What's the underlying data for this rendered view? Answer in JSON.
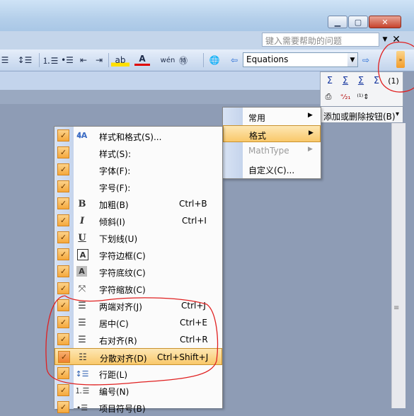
{
  "window": {
    "min_icon": "minimize-icon",
    "max_icon": "maximize-icon",
    "close_icon": "close-icon",
    "min_glyph": "▁",
    "max_glyph": "▢",
    "close_glyph": "✕"
  },
  "help": {
    "placeholder": "键入需要帮助的问题",
    "drop_glyph": "▼",
    "close_glyph": "✕"
  },
  "toolbar": {
    "equation_value": "Equations",
    "equation_drop_glyph": "▼",
    "back_glyph": "⇦",
    "forward_glyph": "⇨",
    "overflow_glyph": "»",
    "glyphs": {
      "distribute": "☰",
      "line_spacing": "↕☰",
      "numbering": "⒈☰",
      "bullets": "•☰",
      "decrease_indent": "⇤",
      "increase_indent": "⇥",
      "highlight": "ab",
      "font_color": "A",
      "phonetic": "wén",
      "enclose": "㊕",
      "globe": "🌐"
    }
  },
  "mathtype_panel": {
    "row1": [
      "Σ",
      "Σ",
      "Σ",
      "Σ",
      "(1)"
    ],
    "row2": [
      "⎙",
      "⁺⁄₂₁",
      "⁽¹⁾⇕"
    ],
    "add_remove_label": "添加或删除按钮(B)",
    "add_remove_arrow": "▾"
  },
  "submenu": {
    "items": [
      {
        "label": "常用",
        "arrow": "▶"
      },
      {
        "label": "格式",
        "arrow": "▶"
      },
      {
        "label": "MathType",
        "arrow": "▶"
      },
      {
        "label": "自定义(C)...",
        "arrow": ""
      }
    ]
  },
  "menu": {
    "check_glyph": "✓",
    "items": [
      {
        "label": "样式和格式(S)...",
        "shortcut": "",
        "icon": "styles-icon",
        "glyph": "𝟒A"
      },
      {
        "label": "样式(S):",
        "shortcut": "",
        "icon": "",
        "glyph": ""
      },
      {
        "label": "字体(F):",
        "shortcut": "",
        "icon": "",
        "glyph": ""
      },
      {
        "label": "字号(F):",
        "shortcut": "",
        "icon": "",
        "glyph": ""
      },
      {
        "label": "加粗(B)",
        "shortcut": "Ctrl+B",
        "icon": "bold-icon",
        "glyph": "B"
      },
      {
        "label": "倾斜(I)",
        "shortcut": "Ctrl+I",
        "icon": "italic-icon",
        "glyph": "I"
      },
      {
        "label": "下划线(U)",
        "shortcut": "",
        "icon": "underline-icon",
        "glyph": "U"
      },
      {
        "label": "字符边框(C)",
        "shortcut": "",
        "icon": "char-border-icon",
        "glyph": "A"
      },
      {
        "label": "字符底纹(C)",
        "shortcut": "",
        "icon": "char-shading-icon",
        "glyph": "A"
      },
      {
        "label": "字符缩放(C)",
        "shortcut": "",
        "icon": "char-scale-icon",
        "glyph": "⤧"
      },
      {
        "label": "两端对齐(J)",
        "shortcut": "Ctrl+J",
        "icon": "justify-icon",
        "glyph": "☰"
      },
      {
        "label": "居中(C)",
        "shortcut": "Ctrl+E",
        "icon": "align-center-icon",
        "glyph": "☰"
      },
      {
        "label": "右对齐(R)",
        "shortcut": "Ctrl+R",
        "icon": "align-right-icon",
        "glyph": "☰"
      },
      {
        "label": "分散对齐(D)",
        "shortcut": "Ctrl+Shift+J",
        "icon": "distribute-icon",
        "glyph": "☷"
      },
      {
        "label": "行距(L)",
        "shortcut": "",
        "icon": "line-spacing-icon",
        "glyph": "↕☰"
      },
      {
        "label": "编号(N)",
        "shortcut": "",
        "icon": "numbering-icon",
        "glyph": "⒈☰"
      },
      {
        "label": "项目符号(B)",
        "shortcut": "",
        "icon": "bullets-icon",
        "glyph": "•☰"
      }
    ]
  },
  "colors": {
    "highlight": "#f9c86a",
    "annotation": "#e02020"
  }
}
